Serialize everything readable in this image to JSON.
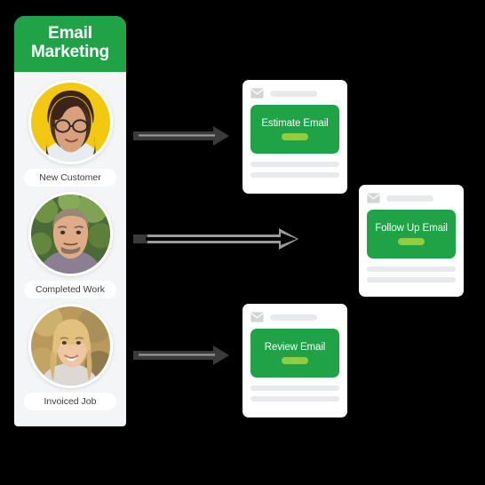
{
  "theme": {
    "background": "#000000",
    "brand_green": "#1fa346",
    "accent_lime": "#93cc3d",
    "card_white": "#ffffff",
    "panel_gray": "#f4f5f6",
    "placeholder_gray": "#e8e9ea",
    "arrow_dark": "#3a3a3a",
    "arrow_light": "#8d8d8d"
  },
  "sidebar": {
    "title_line1": "Email",
    "title_line2": "Marketing",
    "contacts": [
      {
        "label": "New Customer",
        "avatar_name": "avatar-new-customer"
      },
      {
        "label": "Completed Work",
        "avatar_name": "avatar-completed-work"
      },
      {
        "label": "Invoiced Job",
        "avatar_name": "avatar-invoiced-job"
      }
    ]
  },
  "cards": [
    {
      "id": "estimate",
      "label": "Estimate Email",
      "icon": "envelope-icon",
      "cta": "cta-pill",
      "body_lines": 2
    },
    {
      "id": "followup",
      "label": "Follow Up Email",
      "icon": "envelope-icon",
      "cta": "cta-pill",
      "body_lines": 2
    },
    {
      "id": "review",
      "label": "Review Email",
      "icon": "envelope-icon",
      "cta": "cta-pill",
      "body_lines": 2
    }
  ],
  "arrows": [
    {
      "id": "arrow-new-customer-to-estimate",
      "style": "solid-dark"
    },
    {
      "id": "arrow-completed-work-to-followup",
      "style": "outline-light"
    },
    {
      "id": "arrow-invoiced-job-to-review",
      "style": "solid-dark"
    }
  ]
}
